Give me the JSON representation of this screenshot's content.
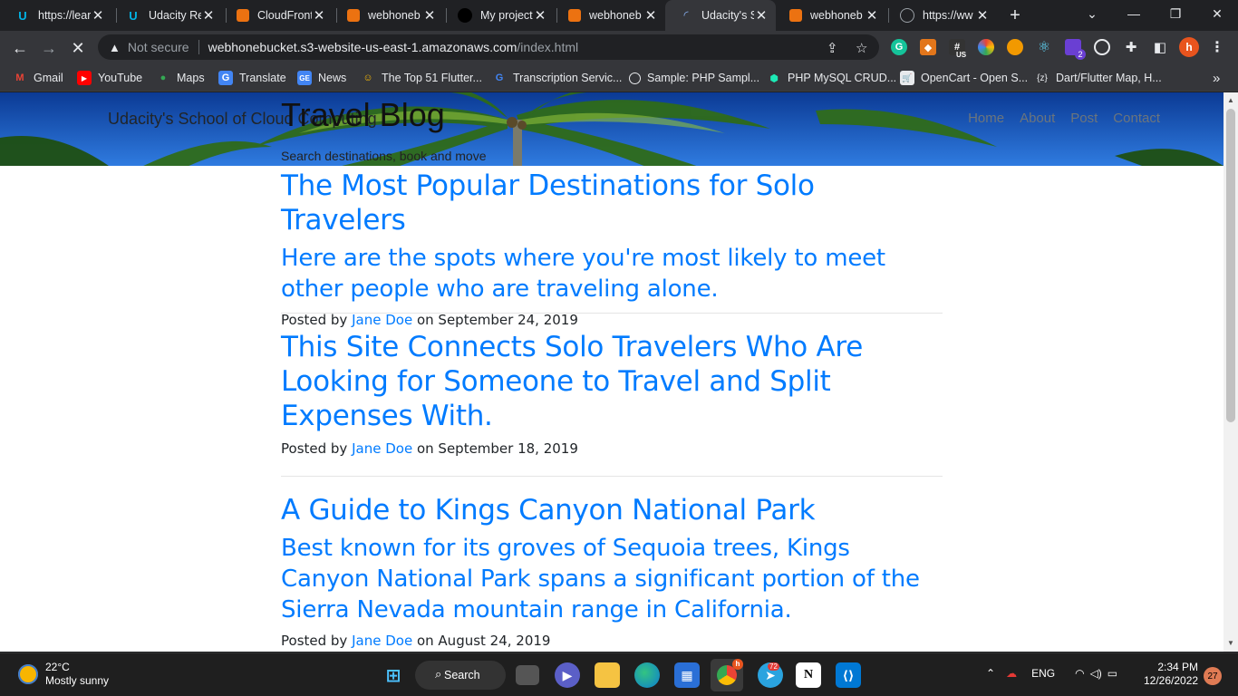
{
  "browser": {
    "tabs": [
      {
        "title": "https://lear",
        "icon": "udacity-icon"
      },
      {
        "title": "Udacity Re",
        "icon": "udacity-icon"
      },
      {
        "title": "CloudFront",
        "icon": "aws-icon"
      },
      {
        "title": "webhoneb",
        "icon": "aws-icon"
      },
      {
        "title": "My project",
        "icon": "github-icon"
      },
      {
        "title": "webhoneb",
        "icon": "aws-icon"
      },
      {
        "title": "Udacity's S",
        "icon": "loading-icon",
        "active": true
      },
      {
        "title": "webhoneb",
        "icon": "aws-icon"
      },
      {
        "title": "https://ww",
        "icon": "globe-icon"
      }
    ],
    "omnibox": {
      "security_label": "Not secure",
      "host": "webhonebucket.s3-website-us-east-1.amazonaws.com",
      "path": "/index.html"
    },
    "profile_initial": "h",
    "extension_badge_us": "US",
    "extension_badge_count": "2",
    "bookmarks": [
      {
        "label": "Gmail",
        "icon": "gmail-icon"
      },
      {
        "label": "YouTube",
        "icon": "youtube-icon"
      },
      {
        "label": "Maps",
        "icon": "maps-icon"
      },
      {
        "label": "Translate",
        "icon": "translate-icon"
      },
      {
        "label": "News",
        "icon": "news-icon"
      },
      {
        "label": "The Top 51 Flutter...",
        "icon": "emoji-icon"
      },
      {
        "label": "Transcription Servic...",
        "icon": "g-icon"
      },
      {
        "label": "Sample: PHP Sampl...",
        "icon": "globe-icon"
      },
      {
        "label": "PHP MySQL CRUD...",
        "icon": "hex-icon"
      },
      {
        "label": "OpenCart - Open S...",
        "icon": "cart-icon"
      },
      {
        "label": "Dart/Flutter Map, H...",
        "icon": "braces-icon"
      }
    ],
    "bookmarks_overflow": "»"
  },
  "site": {
    "brand": "Udacity's School of Cloud Computing",
    "hero_title": "Travel Blog",
    "hero_subtitle": "Search destinations, book and move",
    "nav": [
      "Home",
      "About",
      "Post",
      "Contact"
    ],
    "posts": [
      {
        "title": "The Most Popular Destinations for Solo Travelers",
        "subtitle": "Here are the spots where you're most likely to meet other people who are traveling alone.",
        "posted_by": "Posted by",
        "author": "Jane Doe",
        "on": "on",
        "date": "September 24, 2019"
      },
      {
        "title": "This Site Connects Solo Travelers Who Are Looking for Someone to Travel and Split Expenses With.",
        "subtitle": "",
        "posted_by": "Posted by",
        "author": "Jane Doe",
        "on": "on",
        "date": "September 18, 2019"
      },
      {
        "title": "A Guide to Kings Canyon National Park",
        "subtitle": "Best known for its groves of Sequoia trees, Kings Canyon National Park spans a significant portion of the Sierra Nevada mountain range in California.",
        "posted_by": "Posted by",
        "author": "Jane Doe",
        "on": "on",
        "date": "August 24, 2019"
      }
    ]
  },
  "taskbar": {
    "weather_temp": "22°C",
    "weather_desc": "Mostly sunny",
    "search_label": "Search",
    "chrome_badge": "h",
    "telegram_badge": "72",
    "tray_lang": "ENG",
    "time": "2:34 PM",
    "date": "12/26/2022",
    "notifications": "27"
  }
}
